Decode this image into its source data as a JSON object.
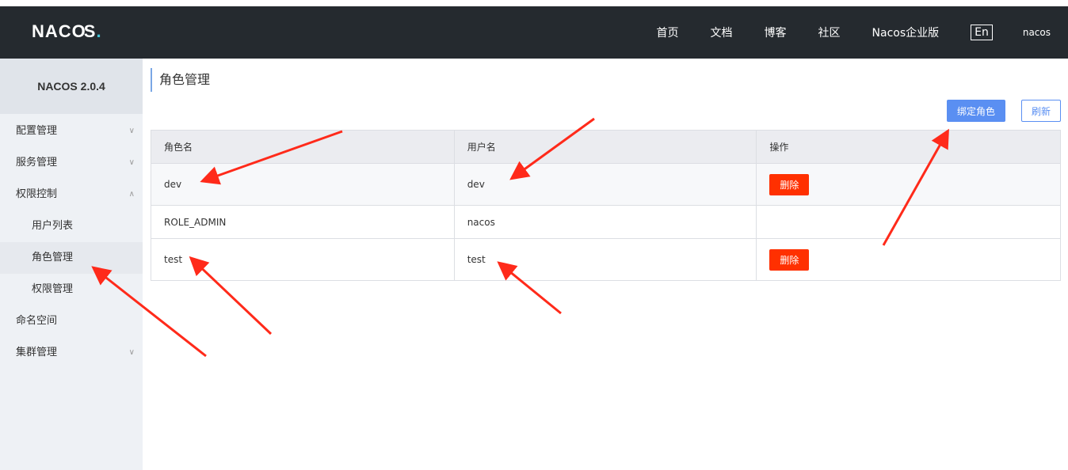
{
  "header": {
    "logo": "NACOS.",
    "nav": [
      "首页",
      "文档",
      "博客",
      "社区",
      "Nacos企业版"
    ],
    "lang": "En",
    "user": "nacos"
  },
  "sidebar": {
    "version": "NACOS 2.0.4",
    "items": [
      {
        "label": "配置管理"
      },
      {
        "label": "服务管理"
      },
      {
        "label": "权限控制"
      },
      {
        "label": "用户列表"
      },
      {
        "label": "角色管理"
      },
      {
        "label": "权限管理"
      },
      {
        "label": "命名空间"
      },
      {
        "label": "集群管理"
      }
    ]
  },
  "main": {
    "title": "角色管理",
    "bind_role_label": "绑定角色",
    "refresh_label": "刷新",
    "table": {
      "headers": [
        "角色名",
        "用户名",
        "操作"
      ],
      "rows": [
        {
          "role": "dev",
          "user": "dev",
          "action": "删除"
        },
        {
          "role": "ROLE_ADMIN",
          "user": "nacos",
          "action": ""
        },
        {
          "role": "test",
          "user": "test",
          "action": "删除"
        }
      ]
    }
  },
  "colors": {
    "header_bg": "#252a2f",
    "primary": "#5a8ff2",
    "danger": "#ff3000",
    "annotation_arrow": "#ff2a1a"
  }
}
